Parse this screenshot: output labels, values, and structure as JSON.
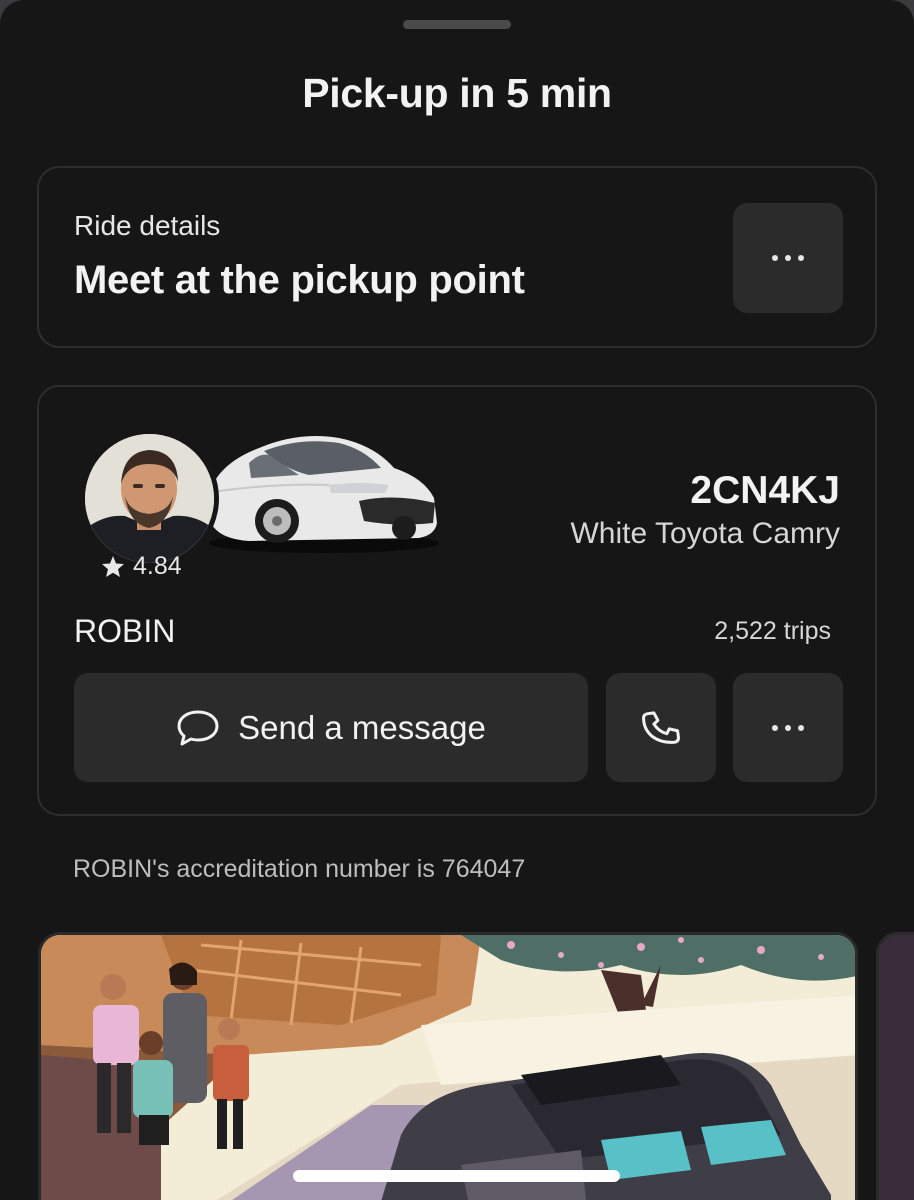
{
  "sheet": {
    "title": "Pick-up in 5 min"
  },
  "ride_details": {
    "label": "Ride details",
    "instruction": "Meet at the pickup point",
    "more_icon": "ellipsis-icon"
  },
  "driver": {
    "rating": "4.84",
    "name": "ROBIN",
    "trips": "2,522 trips",
    "plate": "2CN4KJ",
    "vehicle": "White Toyota Camry",
    "message_label": "Send a message",
    "message_icon": "chat-bubble-icon",
    "call_icon": "phone-icon",
    "more_icon": "ellipsis-icon"
  },
  "accreditation_text": "ROBIN's accreditation number is 764047",
  "colors": {
    "background": "#161616",
    "card_border": "#2e2e2e",
    "button_bg": "#2b2b2b",
    "text_primary": "#f2f2f2",
    "text_secondary": "#bdbdbd"
  }
}
